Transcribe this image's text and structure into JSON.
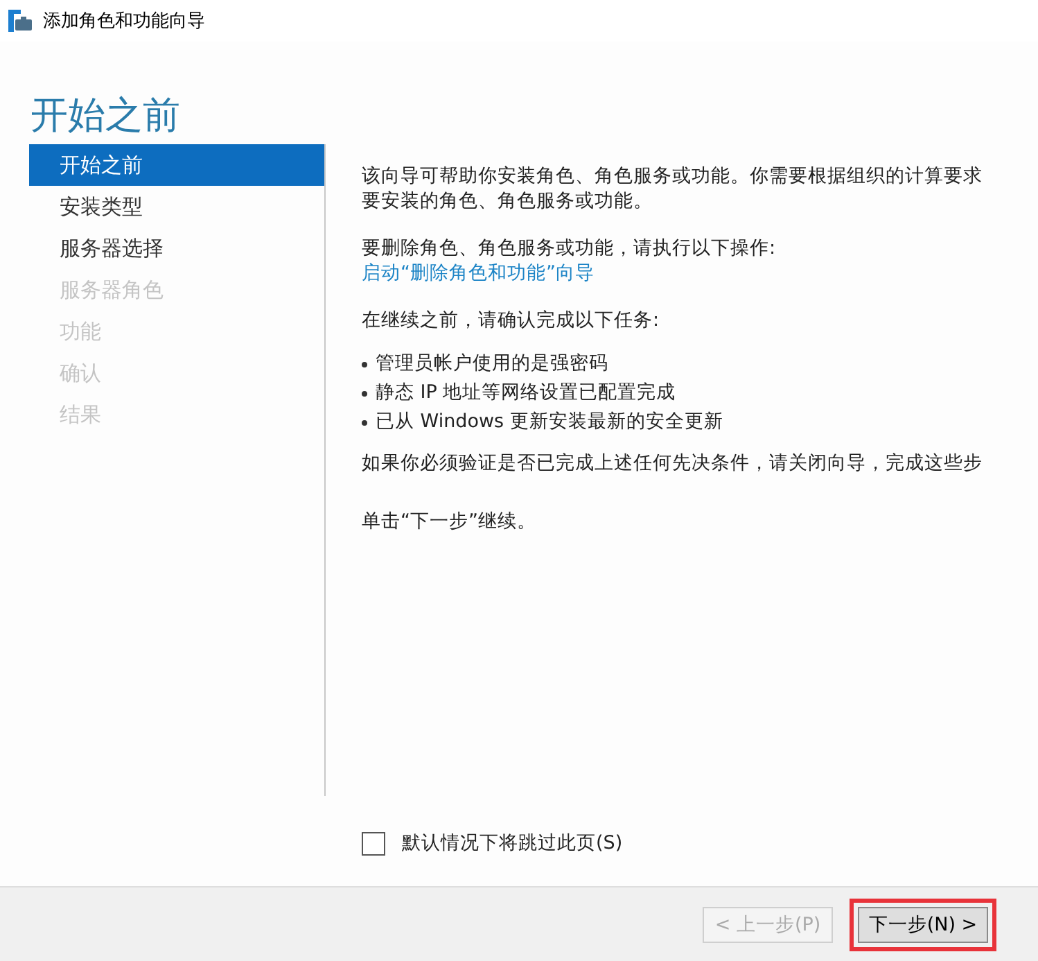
{
  "window": {
    "title": "添加角色和功能向导"
  },
  "heading": "开始之前",
  "sidebar": {
    "items": [
      {
        "label": "开始之前",
        "selected": true,
        "disabled": false
      },
      {
        "label": "安装类型",
        "selected": false,
        "disabled": false
      },
      {
        "label": "服务器选择",
        "selected": false,
        "disabled": false
      },
      {
        "label": "服务器角色",
        "selected": false,
        "disabled": true
      },
      {
        "label": "功能",
        "selected": false,
        "disabled": true
      },
      {
        "label": "确认",
        "selected": false,
        "disabled": true
      },
      {
        "label": "结果",
        "selected": false,
        "disabled": true
      }
    ]
  },
  "content": {
    "intro_lines": [
      "该向导可帮助你安装角色、角色服务或功能。你需要根据组织的计算要求",
      "要安装的角色、角色服务或功能。"
    ],
    "remove_text": "要删除角色、角色服务或功能，请执行以下操作:",
    "remove_link": "启动“删除角色和功能”向导",
    "tasks_intro": "在继续之前，请确认完成以下任务:",
    "tasks": [
      "管理员帐户使用的是强密码",
      "静态 IP 地址等网络设置已配置完成",
      "已从 Windows 更新安装最新的安全更新"
    ],
    "verify_text": "如果你必须验证是否已完成上述任何先决条件，请关闭向导，完成这些步",
    "continue_text": "单击“下一步”继续。"
  },
  "skip_checkbox": {
    "label": "默认情况下将跳过此页(S)",
    "checked": false
  },
  "buttons": [
    {
      "label": "< 上一步(P)",
      "disabled": true,
      "highlighted": false
    },
    {
      "label": "下一步(N) >",
      "disabled": false,
      "highlighted": true
    }
  ]
}
